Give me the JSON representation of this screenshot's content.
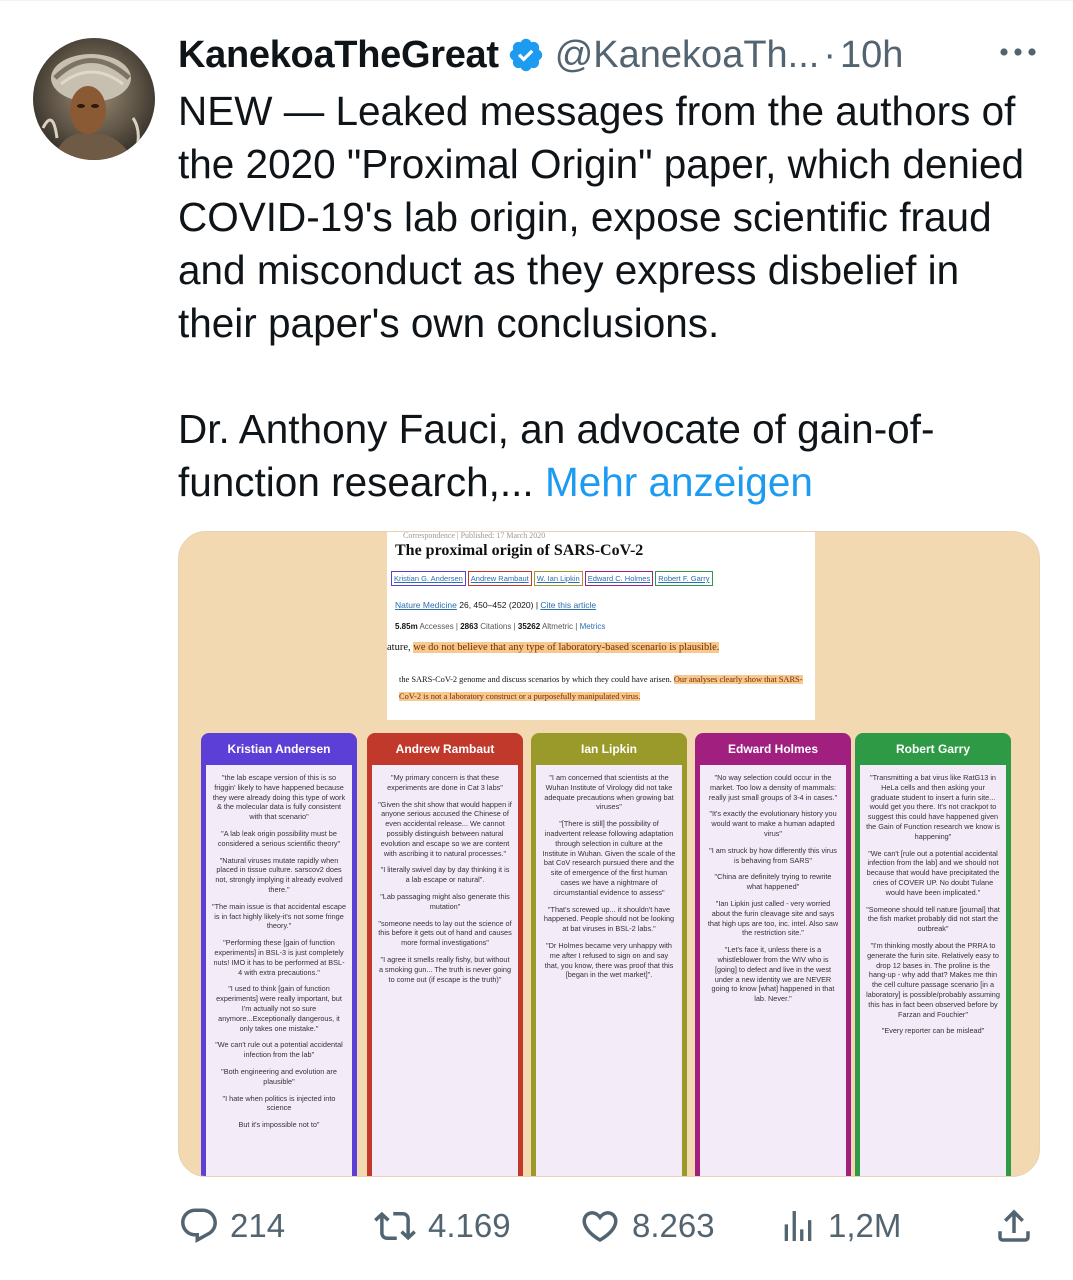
{
  "tweet": {
    "display_name": "KanekoaTheGreat",
    "handle": "@KanekoaTh...",
    "separator": "·",
    "time": "10h",
    "paragraph_1": "NEW — Leaked messages from the authors of the 2020 \"Proximal Origin\" paper, which denied COVID-19's lab origin, expose scientific fraud and misconduct as they express disbelief in their paper's own conclusions.",
    "paragraph_2": "Dr. Anthony Fauci, an advocate of gain-of-function research,...",
    "show_more": "Mehr anzeigen"
  },
  "icons": {
    "verified": "verified-badge-icon",
    "more": "more-options-icon",
    "reply": "reply-icon",
    "retweet": "retweet-icon",
    "like": "heart-icon",
    "views": "views-icon",
    "share": "share-icon"
  },
  "colors": {
    "accent": "#1d9bf0",
    "muted": "#536471",
    "media_bg": "#f3d9b1",
    "highlight": "#f6c98f"
  },
  "media": {
    "paper": {
      "correspondence_line": "Correspondence | Published: 17 March 2020",
      "title": "The proximal origin of SARS-CoV-2",
      "authors": [
        {
          "name": "Kristian G. Andersen",
          "color": "#5b3fd6"
        },
        {
          "name": "Andrew Rambaut",
          "color": "#c0392b"
        },
        {
          "name": "W. Ian Lipkin",
          "color": "#9a9a2a"
        },
        {
          "name": "Edward C. Holmes",
          "color": "#a1207f"
        },
        {
          "name": "Robert F. Garry",
          "color": "#2e9a46"
        }
      ],
      "journal_name": "Nature Medicine",
      "journal_details": " 26, 450–452 (2020) | ",
      "cite_link": "Cite this article",
      "accesses_value": "5.85m",
      "accesses_label": " Accesses | ",
      "citations_value": "2863",
      "citations_label": " Citations | ",
      "altmetric_value": "35262",
      "altmetric_label": " Altmetric | ",
      "metrics_link": "Metrics",
      "quote1_lead": "ature, ",
      "quote1_highlight": "we do not believe that any type of laboratory-based scenario is plausible.",
      "quote2_plain": "the SARS-CoV-2 genome and discuss scenarios by which they could have arisen. ",
      "quote2_highlight": "Our analyses clearly show that SARS-CoV-2 is not a laboratory construct or a purposefully manipulated virus."
    },
    "columns": [
      {
        "name": "Kristian Andersen",
        "color": "#5b3fd6",
        "quotes": [
          "\"the lab escape version of this is so friggin' likely to have happened because they were already doing this type of work & the molecular data is fully consistent with that scenario\"",
          "\"A lab leak origin possibility must be considered a serious scientific theory\"",
          "\"Natural viruses mutate rapidly when placed in tissue culture. sarscov2 does not, strongly implying it already evolved there.\"",
          "\"The main issue is that accidental escape is in fact highly likely-it's not some fringe theory.\"",
          "\"Performing these [gain of function experiments] in BSL-3 is just completely nuts! IMO it has to be performed at BSL-4 with extra precautions.\"",
          "\"I used to think [gain of function experiments] were really important, but I'm actually not so sure anymore...Exceptionally dangerous, it only takes one mistake.\"",
          "\"We can't rule out a potential accidental infection from the lab\"",
          "\"Both engineering and evolution are plausible\"",
          "\"I hate when politics is injected into science",
          "But it's impossible not to\""
        ]
      },
      {
        "name": "Andrew Rambaut",
        "color": "#c0392b",
        "quotes": [
          "\"My primary concern is that these experiments are done in Cat 3 labs\"",
          "\"Given the shit show that would happen if anyone serious accused the Chinese of even accidental release... We cannot possibly distinguish between natural evolution and escape so we are content with ascribing it to natural processes.\"",
          "\"I literally swivel day by day thinking it is a lab escape or natural\".",
          "\"Lab passaging might also generate this mutation\"",
          "\"someone needs to lay out the science of this before it gets out of hand and causes more formal investigations\"",
          "\"I agree it smells really fishy, but without a smoking gun... The truth is never going to come out (if escape is the truth)\""
        ]
      },
      {
        "name": "Ian Lipkin",
        "color": "#9a9a2a",
        "quotes": [
          "\"I am concerned that scientists at the Wuhan Institute of Virology did not take adequate precautions when growing bat viruses\"",
          "\"[There is still] the possibility of inadvertent release following adaptation through selection in culture at the Institute in Wuhan. Given the scale of the bat CoV research pursued there and the site of emergence of the first human cases we have a nightmare of circumstantial evidence to assess\"",
          "\"That's screwed up... it shouldn't have happened. People should not be looking at bat viruses in BSL-2 labs.\"",
          "\"Dr Holmes became very unhappy with me after I refused to sign on and say that, you know, there was proof that this [began in the wet market]\"."
        ]
      },
      {
        "name": "Edward Holmes",
        "color": "#a1207f",
        "quotes": [
          "\"No way selection could occur in the market. Too low a density of mammals: really just small groups of 3-4 in cases.\"",
          "\"It's exactly the evolutionary history you would want to make a human adapted virus\"",
          "\"I am struck by how differently this virus is behaving from SARS\"",
          "\"China are definitely trying to rewrite what happened\"",
          "\"Ian Lipkin just called - very worried about the furin cleavage site and says that high ups are too, inc. intel. Also saw the restriction site.\"",
          "\"Let's face it, unless there is a whistleblower from the WIV who is [going] to defect and live in the west under a new identity we are NEVER going to know [what] happened in that lab. Never.\""
        ]
      },
      {
        "name": "Robert Garry",
        "color": "#2e9a46",
        "quotes": [
          "\"Transmitting a bat virus like RatG13 in HeLa cells and then asking your graduate student to insert a furin site... would get you there. It's not crackpot to suggest this could have happened given the Gain of Function research we know is happening\"",
          "\"We can't [rule out a potential accidental infection from the lab] and we should not because that would have precipitated the cries of COVER UP. No doubt Tulane would have been implicated.\"",
          "\"Someone should tell nature [journal] that the fish market probably did not start the outbreak\"",
          "\"I'm thinking mostly about the PRRA to generate the furin site. Relatively easy to drop 12 bases in. The proline is the hang-up - why add that? Makes me thin the cell culture passage scenario [in a laboratory] is possible/probably assuming this has in fact been observed before by Farzan and Fouchier\"",
          "\"Every reporter can be mislead\""
        ]
      }
    ]
  },
  "stats": {
    "replies": "214",
    "retweets": "4.169",
    "likes": "8.263",
    "views": "1,2M"
  }
}
